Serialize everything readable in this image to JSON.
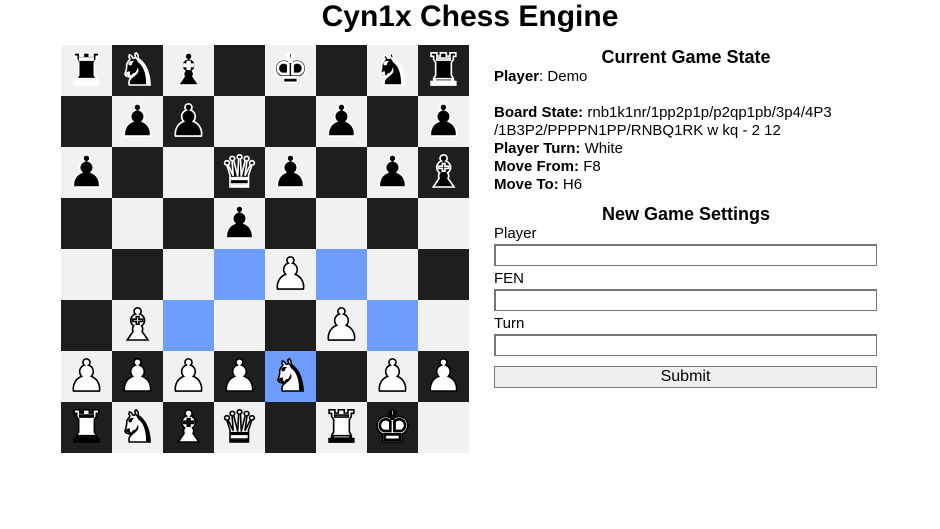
{
  "page": {
    "title": "Cyn1x Chess Engine"
  },
  "colors": {
    "light_square": "#f1f1f1",
    "dark_square": "#1e1e1e",
    "highlight": "#6f9dfd"
  },
  "board": {
    "ranks": [
      [
        "r",
        "n",
        "b",
        "",
        "k",
        "",
        "n",
        "r"
      ],
      [
        "",
        "p",
        "p",
        "",
        "",
        "p",
        "",
        "p"
      ],
      [
        "p",
        "",
        "",
        "q",
        "p",
        "",
        "p",
        "b"
      ],
      [
        "",
        "",
        "",
        "p",
        "",
        "",
        "",
        ""
      ],
      [
        "",
        "",
        "",
        "",
        "P",
        "",
        "",
        ""
      ],
      [
        "",
        "B",
        "",
        "",
        "",
        "P",
        "",
        ""
      ],
      [
        "P",
        "P",
        "P",
        "P",
        "N",
        "",
        "P",
        "P"
      ],
      [
        "R",
        "N",
        "B",
        "Q",
        "",
        "R",
        "K",
        ""
      ]
    ],
    "highlighted": [
      "d4",
      "f4",
      "c3",
      "g3",
      "e2"
    ]
  },
  "game_state": {
    "title": "Current Game State",
    "player_label": "Player",
    "player_value": "Demo",
    "board_state_label": "Board State:",
    "board_state_value": "rnb1k1nr/1pp2p1p/p2qp1pb/3p4/4P3\n/1B3P2/PPPPN1PP/RNBQ1RK w kq - 2 12",
    "turn_label": "Player Turn:",
    "turn_value": "White",
    "from_label": "Move From:",
    "from_value": "F8",
    "to_label": "Move To:",
    "to_value": "H6"
  },
  "settings": {
    "title": "New Game Settings",
    "player_label": "Player",
    "player_value": "",
    "fen_label": "FEN",
    "fen_value": "",
    "turn_label": "Turn",
    "turn_value": "",
    "submit_label": "Submit"
  }
}
